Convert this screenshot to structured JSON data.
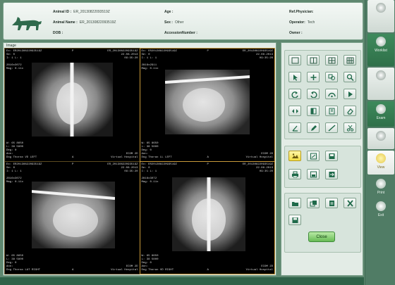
{
  "header": {
    "animal_id_label": "Animal ID :",
    "animal_id": "ER_20130822093519Z",
    "animal_name_label": "Animal Name :",
    "animal_name": "ER_20130822093519Z",
    "dob_label": "DOB :",
    "dob": "",
    "age_label": "Age :",
    "age": "",
    "sex_label": "Sex :",
    "sex": "Other",
    "accession_label": "AccessionNumber :",
    "accession": "",
    "ref_physician_label": "Ref.Physician:",
    "ref_physician": "",
    "operator_label": "Operator:",
    "operator": "Tech",
    "owner_label": "Owner :",
    "owner": ""
  },
  "main": {
    "title": "Image"
  },
  "viewports": [
    {
      "tl": "Ex: ER20130822093519Z\nSe: 0\nI: 1 L: 1\n\n2816x3072\nMag: 0.11x",
      "tr": "ER_20130822093519Z\n22.08.2013\n09:35:20",
      "bl": "W: 65 8650\nL: 38 5800\nDeg: 0\nAnn:\nDog Thorax VD LEFT",
      "br": "ECOM 2D\nVirtual Hospital",
      "mark": "P",
      "side": "A"
    },
    {
      "tl": "Ex: ER20130822093519Z\nSe: 0\nI: 1 L: 1\n\n2816x2911\nMag: 0.11x",
      "tr": "ER_20130822093519Z\n22.08.2013\n09:35:20",
      "bl": "W: 65 8650\nL: 38 5800\nDeg: 0\nAnn:\nDog Thorax LL LEFT",
      "br": "ECOM 2D\nVirtual Hospital",
      "mark": "P",
      "side": "A"
    },
    {
      "tl": "Ex: ER20130822093519Z\nSe: 0\nI: 1 L: 1\n\n2816x3072\nMag: 0.11x",
      "tr": "ER_20130822093519Z\n22.08.2013\n09:35:20",
      "bl": "W: 65 8650\nL: 38 5800\nDeg: 0\nAnn:\nDog Thorax LAT RIGHT",
      "br": "ECOM 2D\nVirtual Hospital",
      "mark": "P",
      "side": "A"
    },
    {
      "tl": "Ex: ER20130822093519Z\nSe: 0\nI: 1 L: 1\n\n2816x3072\nMag: 0.11x",
      "tr": "ER_20130822093519Z\n22.08.2013\n09:35:20",
      "bl": "W: 65 8650\nL: 38 5800\nDeg: 0\nAnn:\nDog Thorax VD RIGHT",
      "br": "ECOM 2D\nVirtual Hospital",
      "mark": "P",
      "side": "A"
    }
  ],
  "tools": {
    "close_label": "Close"
  },
  "side_nav": [
    {
      "label": "",
      "icon": "settings-icon",
      "style": "light"
    },
    {
      "label": "Worklist",
      "icon": "worklist-icon",
      "style": "dark"
    },
    {
      "label": "",
      "icon": "patient-icon",
      "style": "light"
    },
    {
      "label": "Exam",
      "icon": "exam-icon",
      "style": "dark"
    },
    {
      "label": "",
      "icon": "image-icon",
      "style": "light"
    },
    {
      "label": "View",
      "icon": "view-icon",
      "style": "light"
    },
    {
      "label": "Print",
      "icon": "print-icon",
      "style": "dark"
    },
    {
      "label": "Exit",
      "icon": "exit-icon",
      "style": "dark"
    }
  ],
  "colors": {
    "accent": "#5f8870",
    "highlight": "#f1dd45",
    "close_button": "#67bb55"
  }
}
